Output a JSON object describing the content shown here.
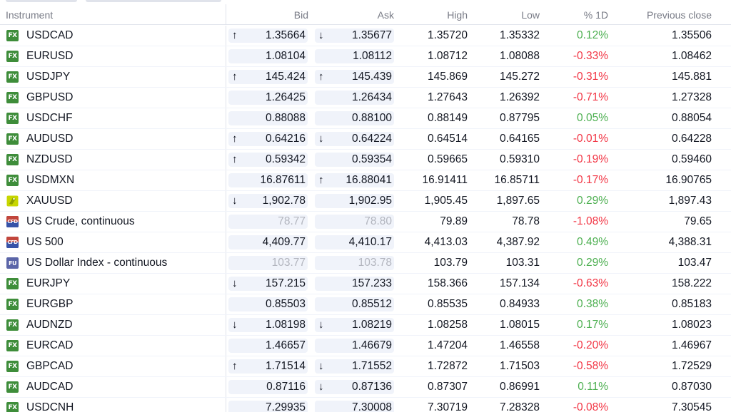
{
  "headers": {
    "instrument": "Instrument",
    "bid": "Bid",
    "ask": "Ask",
    "high": "High",
    "low": "Low",
    "change_pct": "% 1D",
    "prev_close": "Previous close"
  },
  "colors": {
    "positive": "#4caf50",
    "negative": "#f23645",
    "fx_badge": "#3e8d3a",
    "pill_bg": "#f0f3fa"
  },
  "rows": [
    {
      "badge": "FX",
      "badge_type": "fx",
      "name": "USDCAD",
      "bid_arrow": "up",
      "bid": "1.35664",
      "ask_arrow": "down",
      "ask": "1.35677",
      "high": "1.35720",
      "low": "1.35332",
      "pct": "0.12%",
      "pct_dir": "pos",
      "prev": "1.35506"
    },
    {
      "badge": "FX",
      "badge_type": "fx",
      "name": "EURUSD",
      "bid_arrow": "",
      "bid": "1.08104",
      "ask_arrow": "",
      "ask": "1.08112",
      "high": "1.08712",
      "low": "1.08088",
      "pct": "-0.33%",
      "pct_dir": "neg",
      "prev": "1.08462"
    },
    {
      "badge": "FX",
      "badge_type": "fx",
      "name": "USDJPY",
      "bid_arrow": "up",
      "bid": "145.424",
      "ask_arrow": "up",
      "ask": "145.439",
      "high": "145.869",
      "low": "145.272",
      "pct": "-0.31%",
      "pct_dir": "neg",
      "prev": "145.881"
    },
    {
      "badge": "FX",
      "badge_type": "fx",
      "name": "GBPUSD",
      "bid_arrow": "",
      "bid": "1.26425",
      "ask_arrow": "",
      "ask": "1.26434",
      "high": "1.27643",
      "low": "1.26392",
      "pct": "-0.71%",
      "pct_dir": "neg",
      "prev": "1.27328"
    },
    {
      "badge": "FX",
      "badge_type": "fx",
      "name": "USDCHF",
      "bid_arrow": "",
      "bid": "0.88088",
      "ask_arrow": "",
      "ask": "0.88100",
      "high": "0.88149",
      "low": "0.87795",
      "pct": "0.05%",
      "pct_dir": "pos",
      "prev": "0.88054"
    },
    {
      "badge": "FX",
      "badge_type": "fx",
      "name": "AUDUSD",
      "bid_arrow": "up",
      "bid": "0.64216",
      "ask_arrow": "down",
      "ask": "0.64224",
      "high": "0.64514",
      "low": "0.64165",
      "pct": "-0.01%",
      "pct_dir": "neg",
      "prev": "0.64228"
    },
    {
      "badge": "FX",
      "badge_type": "fx",
      "name": "NZDUSD",
      "bid_arrow": "up",
      "bid": "0.59342",
      "ask_arrow": "",
      "ask": "0.59354",
      "high": "0.59665",
      "low": "0.59310",
      "pct": "-0.19%",
      "pct_dir": "neg",
      "prev": "0.59460"
    },
    {
      "badge": "FX",
      "badge_type": "fx",
      "name": "USDMXN",
      "bid_arrow": "",
      "bid": "16.87611",
      "ask_arrow": "up",
      "ask": "16.88041",
      "high": "16.91411",
      "low": "16.85711",
      "pct": "-0.17%",
      "pct_dir": "neg",
      "prev": "16.90765"
    },
    {
      "badge": "",
      "badge_type": "gold",
      "name": "XAUUSD",
      "bid_arrow": "down",
      "bid": "1,902.78",
      "ask_arrow": "",
      "ask": "1,902.95",
      "high": "1,905.45",
      "low": "1,897.65",
      "pct": "0.29%",
      "pct_dir": "pos",
      "prev": "1,897.43"
    },
    {
      "badge": "CFD",
      "badge_type": "cfd",
      "name": "US Crude, continuous",
      "bid_arrow": "",
      "bid": "78.77",
      "bid_muted": true,
      "ask_arrow": "",
      "ask": "78.80",
      "ask_muted": true,
      "high": "79.89",
      "low": "78.78",
      "pct": "-1.08%",
      "pct_dir": "neg",
      "prev": "79.65"
    },
    {
      "badge": "CFD",
      "badge_type": "cfd",
      "name": "US 500",
      "bid_arrow": "",
      "bid": "4,409.77",
      "ask_arrow": "",
      "ask": "4,410.17",
      "high": "4,413.03",
      "low": "4,387.92",
      "pct": "0.49%",
      "pct_dir": "pos",
      "prev": "4,388.31"
    },
    {
      "badge": "FU",
      "badge_type": "fu",
      "name": "US Dollar Index - continuous",
      "bid_arrow": "",
      "bid": "103.77",
      "bid_muted": true,
      "ask_arrow": "",
      "ask": "103.78",
      "ask_muted": true,
      "high": "103.79",
      "low": "103.31",
      "pct": "0.29%",
      "pct_dir": "pos",
      "prev": "103.47"
    },
    {
      "badge": "FX",
      "badge_type": "fx",
      "name": "EURJPY",
      "bid_arrow": "down",
      "bid": "157.215",
      "ask_arrow": "",
      "ask": "157.233",
      "high": "158.366",
      "low": "157.134",
      "pct": "-0.63%",
      "pct_dir": "neg",
      "prev": "158.222"
    },
    {
      "badge": "FX",
      "badge_type": "fx",
      "name": "EURGBP",
      "bid_arrow": "",
      "bid": "0.85503",
      "ask_arrow": "",
      "ask": "0.85512",
      "high": "0.85535",
      "low": "0.84933",
      "pct": "0.38%",
      "pct_dir": "pos",
      "prev": "0.85183"
    },
    {
      "badge": "FX",
      "badge_type": "fx",
      "name": "AUDNZD",
      "bid_arrow": "down",
      "bid": "1.08198",
      "ask_arrow": "down",
      "ask": "1.08219",
      "high": "1.08258",
      "low": "1.08015",
      "pct": "0.17%",
      "pct_dir": "pos",
      "prev": "1.08023"
    },
    {
      "badge": "FX",
      "badge_type": "fx",
      "name": "EURCAD",
      "bid_arrow": "",
      "bid": "1.46657",
      "ask_arrow": "",
      "ask": "1.46679",
      "high": "1.47204",
      "low": "1.46558",
      "pct": "-0.20%",
      "pct_dir": "neg",
      "prev": "1.46967"
    },
    {
      "badge": "FX",
      "badge_type": "fx",
      "name": "GBPCAD",
      "bid_arrow": "up",
      "bid": "1.71514",
      "ask_arrow": "down",
      "ask": "1.71552",
      "high": "1.72872",
      "low": "1.71503",
      "pct": "-0.58%",
      "pct_dir": "neg",
      "prev": "1.72529"
    },
    {
      "badge": "FX",
      "badge_type": "fx",
      "name": "AUDCAD",
      "bid_arrow": "",
      "bid": "0.87116",
      "ask_arrow": "down",
      "ask": "0.87136",
      "high": "0.87307",
      "low": "0.86991",
      "pct": "0.11%",
      "pct_dir": "pos",
      "prev": "0.87030"
    },
    {
      "badge": "FX",
      "badge_type": "fx",
      "name": "USDCNH",
      "bid_arrow": "",
      "bid": "7.29935",
      "ask_arrow": "",
      "ask": "7.30008",
      "high": "7.30719",
      "low": "7.28328",
      "pct": "-0.08%",
      "pct_dir": "neg",
      "prev": "7.30545"
    }
  ]
}
